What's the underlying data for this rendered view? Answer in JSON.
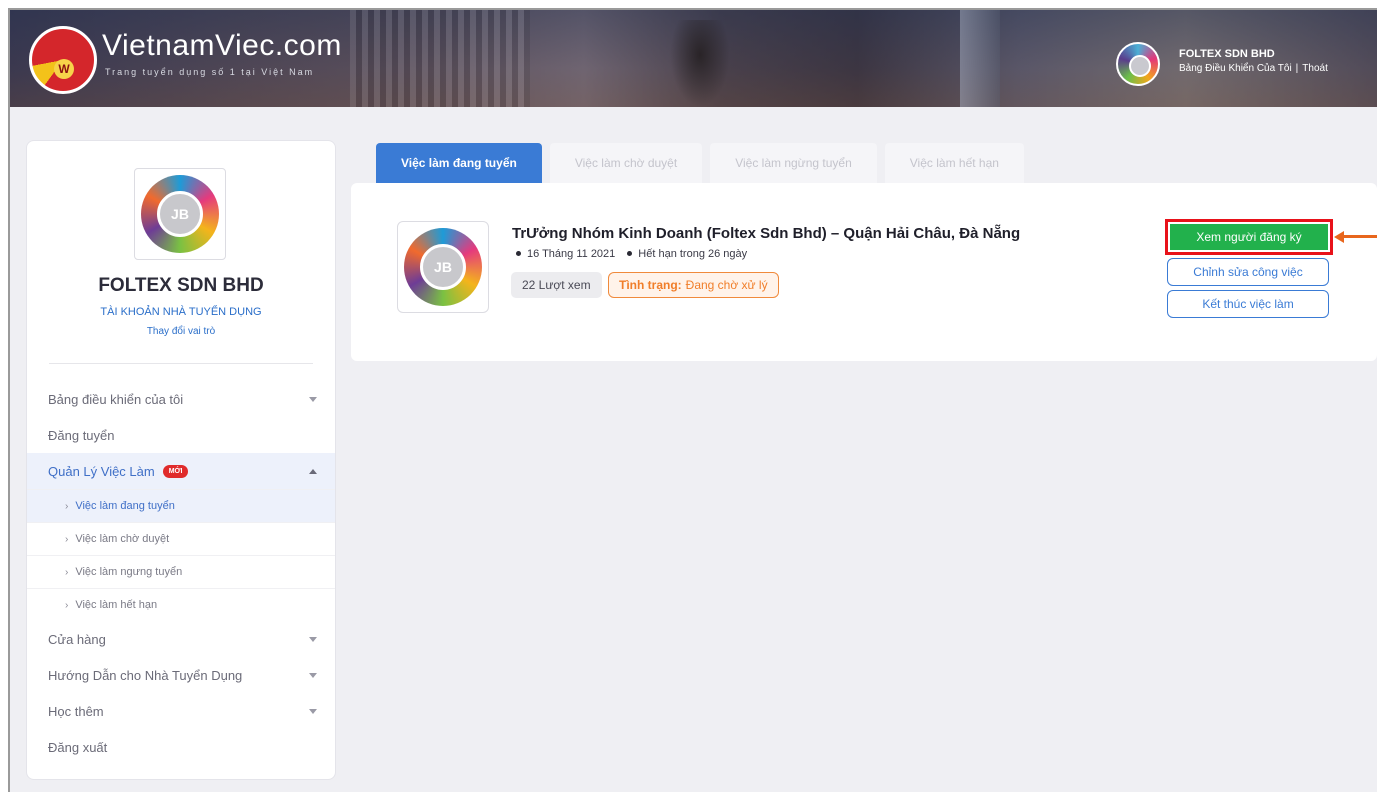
{
  "header": {
    "brand_name": "VietnamViec.com",
    "tagline": "Trang tuyển dụng số 1 tại Việt Nam",
    "logo_letter": "W",
    "user_name": "FOLTEX SDN BHD",
    "dashboard_link": "Bảng Điều Khiển Của Tôi",
    "separator": "|",
    "logout_link": "Thoát"
  },
  "sidebar": {
    "company_name": "FOLTEX SDN BHD",
    "account_type": "TÀI KHOẢN NHÀ TUYỂN DỤNG",
    "change_role": "Thay đổi vai trò",
    "logo_text": "JB",
    "menu": {
      "dashboard": "Bảng điều khiển của tôi",
      "post_job": "Đăng tuyển",
      "job_management": "Quản Lý Việc Làm",
      "new_badge": "MỚI",
      "store": "Cửa hàng",
      "guide": "Hướng Dẫn cho Nhà Tuyển Dụng",
      "learn_more": "Học thêm",
      "logout": "Đăng xuất"
    },
    "submenu": [
      {
        "label": "Việc làm đang tuyển"
      },
      {
        "label": "Việc làm chờ duyệt"
      },
      {
        "label": "Việc làm ngưng tuyển"
      },
      {
        "label": "Việc làm hết hạn"
      }
    ]
  },
  "tabs": [
    {
      "label": "Việc làm đang tuyển",
      "active": true
    },
    {
      "label": "Việc làm chờ duyệt",
      "active": false
    },
    {
      "label": "Việc làm ngừng tuyển",
      "active": false
    },
    {
      "label": "Việc làm hết hạn",
      "active": false
    }
  ],
  "job": {
    "title": "TrƯởng Nhóm Kinh Doanh (Foltex Sdn Bhd) – Quận Hải Châu, Đà Nẵng",
    "posted_date": "16 Tháng 11 2021",
    "expiry": "Hết hạn trong 26 ngày",
    "views": "22 Lượt xem",
    "status_label": "Tình trạng:",
    "status_value": "Đang chờ xử lý",
    "logo_text": "JB"
  },
  "actions": {
    "view_applicants": "Xem người đăng ký",
    "edit_job": "Chỉnh sửa công việc",
    "end_job": "Kết thúc việc làm"
  },
  "colors": {
    "primary_blue": "#3a7bd5",
    "highlight_red": "#e8121a",
    "green_button": "#22b14c",
    "status_orange": "#f07e2a",
    "arrow_orange": "#e8661c"
  }
}
